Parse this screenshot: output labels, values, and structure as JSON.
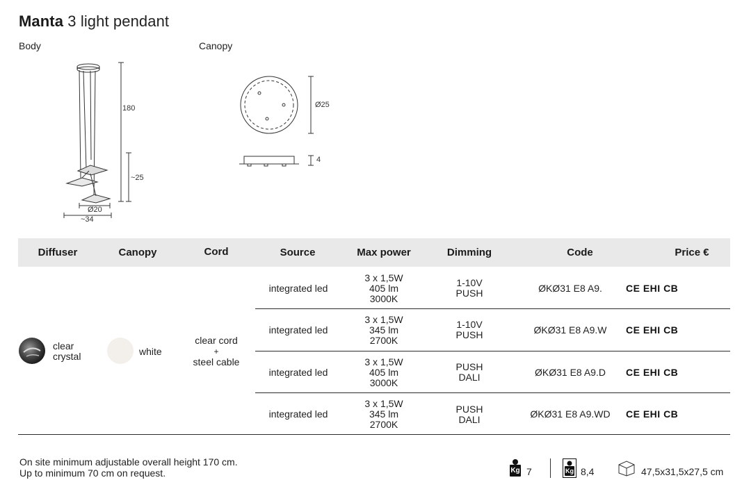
{
  "title": {
    "name": "Manta",
    "subtitle": "3 light pendant"
  },
  "drawing": {
    "body_label": "Body",
    "canopy_label": "Canopy",
    "dim_180": "180",
    "dim_25": "~25",
    "dim_20": "Ø20",
    "dim_34": "~34",
    "dim_canopy_d": "Ø25",
    "dim_canopy_h": "4"
  },
  "table": {
    "headers": [
      "Diffuser",
      "Canopy",
      "Cord",
      "Source",
      "Max power",
      "Dimming",
      "Code",
      "Price €"
    ],
    "diffuser": "clear crystal",
    "canopy": "white",
    "cord_line1": "clear cord",
    "cord_plus": "+",
    "cord_line2": "steel cable",
    "rows": [
      {
        "source": "integrated led",
        "power1": "3 x 1,5W",
        "power2": "405 lm",
        "power3": "3000K",
        "dim1": "1-10V",
        "dim2": "PUSH",
        "code": "ØKØ31 E8 A9.",
        "certs": "CE EHI CB"
      },
      {
        "source": "integrated led",
        "power1": "3 x 1,5W",
        "power2": "345 lm",
        "power3": "2700K",
        "dim1": "1-10V",
        "dim2": "PUSH",
        "code": "ØKØ31 E8 A9.W",
        "certs": "CE EHI CB"
      },
      {
        "source": "integrated led",
        "power1": "3 x 1,5W",
        "power2": "405 lm",
        "power3": "3000K",
        "dim1": "PUSH",
        "dim2": "DALI",
        "code": "ØKØ31 E8 A9.D",
        "certs": "CE EHI CB"
      },
      {
        "source": "integrated led",
        "power1": "3 x 1,5W",
        "power2": "345 lm",
        "power3": "2700K",
        "dim1": "PUSH",
        "dim2": "DALI",
        "code": "ØKØ31 E8 A9.WD",
        "certs": "CE EHI CB"
      }
    ]
  },
  "footer": {
    "note1": "On site minimum adjustable overall height 170 cm.",
    "note2": "Up to minimum 70 cm on request.",
    "weight_net": "7",
    "weight_gross": "8,4",
    "package": "47,5x31,5x27,5 cm",
    "kg_label": "Kg"
  },
  "colors": {
    "header_bg": "#e9e9e9",
    "line": "#2a2a2a"
  }
}
